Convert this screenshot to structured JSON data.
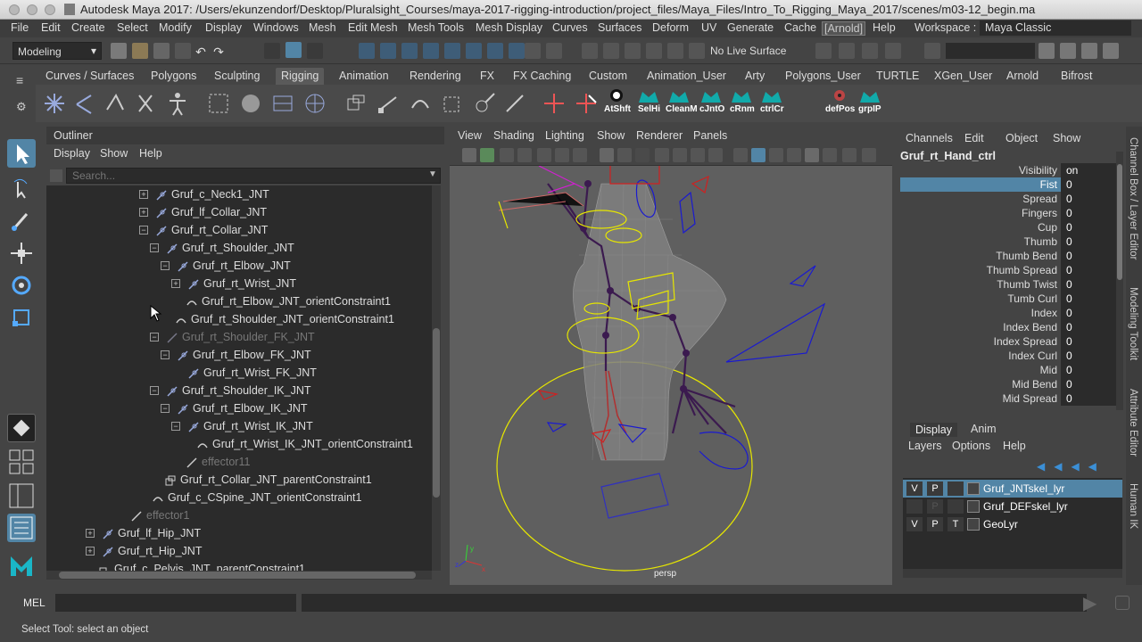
{
  "titlebar": {
    "title": "Autodesk Maya 2017: /Users/ekunzendorf/Desktop/Pluralsight_Courses/maya-2017-rigging-introduction/project_files/Maya_Files/Intro_To_Rigging_Maya_2017/scenes/m03-12_begin.ma"
  },
  "menubar": {
    "items": [
      "File",
      "Edit",
      "Create",
      "Select",
      "Modify",
      "Display",
      "Windows",
      "Mesh",
      "Edit Mesh",
      "Mesh Tools",
      "Mesh Display",
      "Curves",
      "Surfaces",
      "Deform",
      "UV",
      "Generate",
      "Cache",
      "[Arnold]",
      "Help"
    ],
    "workspace_label": "Workspace :",
    "workspace_value": "Maya Classic"
  },
  "statusline": {
    "mode": "Modeling",
    "live_surface": "No Live Surface"
  },
  "shelf": {
    "tabs": [
      "Curves / Surfaces",
      "Polygons",
      "Sculpting",
      "Rigging",
      "Animation",
      "Rendering",
      "FX",
      "FX Caching",
      "Custom",
      "Animation_User",
      "Arty",
      "Polygons_User",
      "TURTLE",
      "XGen_User",
      "Arnold",
      "Bifrost"
    ],
    "active_tab": "Rigging",
    "buttons": [
      "AtShft",
      "SelHi",
      "CleanM",
      "cJntO",
      "cRnm",
      "ctrlCr",
      "defPos",
      "grpIP"
    ]
  },
  "outliner": {
    "title": "Outliner",
    "menu": [
      "Display",
      "Show",
      "Help"
    ],
    "search_placeholder": "Search...",
    "rows": [
      {
        "label": "Gruf_c_Neck1_JNT",
        "grey": false
      },
      {
        "label": "Gruf_lf_Collar_JNT",
        "grey": false
      },
      {
        "label": "Gruf_rt_Collar_JNT",
        "grey": false
      },
      {
        "label": "Gruf_rt_Shoulder_JNT",
        "grey": false
      },
      {
        "label": "Gruf_rt_Elbow_JNT",
        "grey": false
      },
      {
        "label": "Gruf_rt_Wrist_JNT",
        "grey": false
      },
      {
        "label": "Gruf_rt_Elbow_JNT_orientConstraint1",
        "grey": false
      },
      {
        "label": "Gruf_rt_Shoulder_JNT_orientConstraint1",
        "grey": false
      },
      {
        "label": "Gruf_rt_Shoulder_FK_JNT",
        "grey": true
      },
      {
        "label": "Gruf_rt_Elbow_FK_JNT",
        "grey": false
      },
      {
        "label": "Gruf_rt_Wrist_FK_JNT",
        "grey": false
      },
      {
        "label": "Gruf_rt_Shoulder_IK_JNT",
        "grey": false
      },
      {
        "label": "Gruf_rt_Elbow_IK_JNT",
        "grey": false
      },
      {
        "label": "Gruf_rt_Wrist_IK_JNT",
        "grey": false
      },
      {
        "label": "Gruf_rt_Wrist_IK_JNT_orientConstraint1",
        "grey": false
      },
      {
        "label": "effector11",
        "grey": true
      },
      {
        "label": "Gruf_rt_Collar_JNT_parentConstraint1",
        "grey": false
      },
      {
        "label": "Gruf_c_CSpine_JNT_orientConstraint1",
        "grey": false
      },
      {
        "label": "effector1",
        "grey": true
      },
      {
        "label": "Gruf_lf_Hip_JNT",
        "grey": false
      },
      {
        "label": "Gruf_rt_Hip_JNT",
        "grey": false
      },
      {
        "label": "Gruf_c_Pelvis_JNT_parentConstraint1",
        "grey": false
      }
    ]
  },
  "viewport": {
    "menu": [
      "View",
      "Shading",
      "Lighting",
      "Show",
      "Renderer",
      "Panels"
    ],
    "camera": "persp"
  },
  "channelbox": {
    "menu": [
      "Channels",
      "Edit",
      "Object",
      "Show"
    ],
    "object": "Gruf_rt_Hand_ctrl",
    "attrs": [
      {
        "name": "Visibility",
        "value": "on"
      },
      {
        "name": "Fist",
        "value": "0"
      },
      {
        "name": "Spread",
        "value": "0"
      },
      {
        "name": "Fingers",
        "value": "0"
      },
      {
        "name": "Cup",
        "value": "0"
      },
      {
        "name": "Thumb",
        "value": "0"
      },
      {
        "name": "Thumb Bend",
        "value": "0"
      },
      {
        "name": "Thumb Spread",
        "value": "0"
      },
      {
        "name": "Thumb Twist",
        "value": "0"
      },
      {
        "name": "Tumb Curl",
        "value": "0"
      },
      {
        "name": "Index",
        "value": "0"
      },
      {
        "name": "Index Bend",
        "value": "0"
      },
      {
        "name": "Index Spread",
        "value": "0"
      },
      {
        "name": "Index Curl",
        "value": "0"
      },
      {
        "name": "Mid",
        "value": "0"
      },
      {
        "name": "Mid Bend",
        "value": "0"
      },
      {
        "name": "Mid Spread",
        "value": "0"
      }
    ]
  },
  "layers": {
    "tabs": [
      "Display",
      "Anim"
    ],
    "menu": [
      "Layers",
      "Options",
      "Help"
    ],
    "rows": [
      {
        "v": "V",
        "p": "P",
        "t": "",
        "name": "Gruf_JNTskel_lyr"
      },
      {
        "v": "",
        "p": "P",
        "t": "",
        "name": "Gruf_DEFskel_lyr"
      },
      {
        "v": "V",
        "p": "P",
        "t": "T",
        "name": "GeoLyr"
      }
    ]
  },
  "sidetabs": [
    "Channel Box / Layer Editor",
    "Modeling Toolkit",
    "Attribute Editor",
    "Human IK"
  ],
  "cmdline": {
    "label": "MEL"
  },
  "helpline": {
    "text": "Select Tool: select an object"
  },
  "colors": {
    "selection": "#5285a6",
    "panel": "#444444",
    "field": "#2b2b2b"
  }
}
